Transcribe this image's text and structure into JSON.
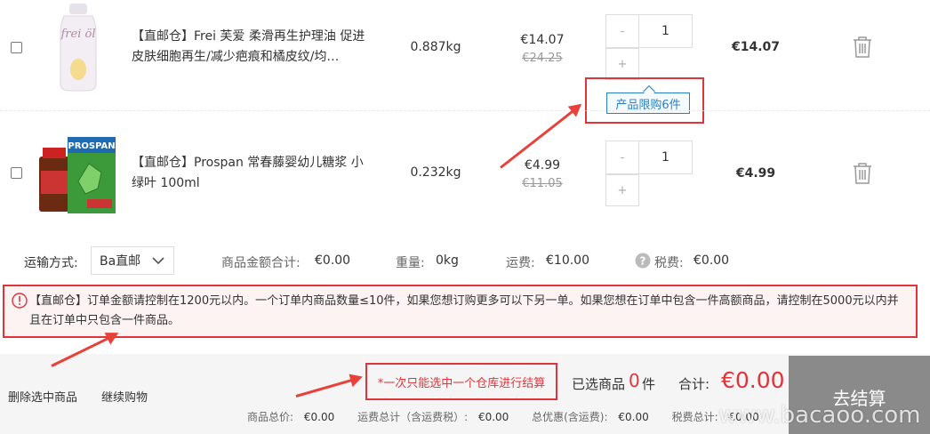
{
  "items": [
    {
      "name": "【直邮仓】Frei 芙爱 柔滑再生护理油 促进皮肤细胞再生/减少疤痕和橘皮纹/均…",
      "weight": "0.887kg",
      "price": "€14.07",
      "old_price": "€24.25",
      "qty": "1",
      "minus": "-",
      "plus": "+",
      "subtotal": "€14.07",
      "limit_tip": "产品限购6件",
      "brand_logo": "frei öl"
    },
    {
      "name": "【直邮仓】Prospan 常春藤婴幼儿糖浆 小绿叶 100ml",
      "weight": "0.232kg",
      "price": "€4.99",
      "old_price": "€11.05",
      "qty": "1",
      "minus": "-",
      "plus": "+",
      "subtotal": "€4.99",
      "brand_logo": "PROSPAN"
    }
  ],
  "shipping": {
    "label": "运输方式:",
    "method": "Ba直邮",
    "goods_total_label": "商品金额合计:",
    "goods_total": "€0.00",
    "weight_label": "重量:",
    "weight": "0kg",
    "fee_label": "运费:",
    "fee": "€10.00",
    "tax_label": "税费:",
    "tax": "€0.00"
  },
  "notice": "【直邮仓】订单金额请控制在1200元以内。一个订单内商品数量≤10件，如果您想订购更多可以下另一单。如果您想在订单中包含一件高额商品，请控制在5000元以内并且在订单中只包含一件商品。",
  "footer": {
    "delete_selected": "删除选中商品",
    "continue_shopping": "继续购物",
    "warehouse_tip": "*一次只能选中一个仓库进行结算",
    "selected_label": "已选商品",
    "selected_count": "0",
    "selected_unit": "件",
    "total_label": "合计:",
    "total": "€0.00",
    "checkout": "去结算",
    "goods_sum_label": "商品总价:",
    "goods_sum": "€0.00",
    "ship_total_label": "运费总计（含运费税）:",
    "ship_total": "€0.00",
    "discount_label": "总优惠(含运费):",
    "discount": "€0.00",
    "tax_total_label": "税费总计:",
    "tax_total": "€0.00"
  },
  "watermark": "www.bacaoo.com",
  "colors": {
    "accent_red": "#e0343b",
    "checkout_bg": "#8a8a8a",
    "tip_blue": "#2a7fc1"
  },
  "icons": [
    "trash-icon",
    "chevron-down-icon",
    "question-circle-icon",
    "alert-circle-icon",
    "arrow-annotation"
  ]
}
